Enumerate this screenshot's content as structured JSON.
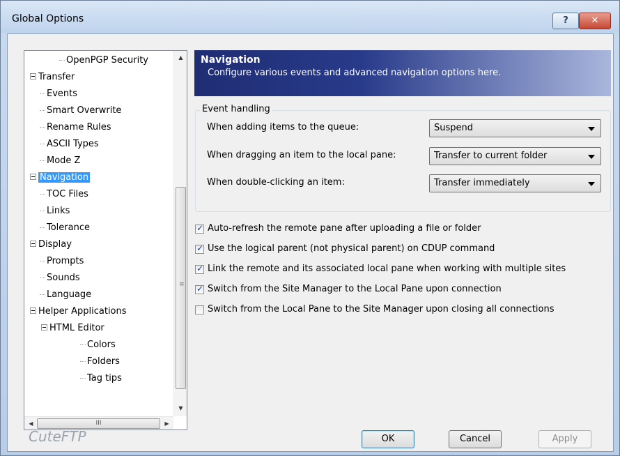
{
  "window": {
    "title": "Global Options",
    "help_label": "?",
    "close_label": "✕"
  },
  "tree": {
    "items": [
      {
        "label": "OpenPGP Security",
        "level": 2,
        "expander": false,
        "selected": false
      },
      {
        "label": "Transfer",
        "level": 0,
        "expander": true,
        "selected": false
      },
      {
        "label": "Events",
        "level": 1,
        "expander": false,
        "selected": false
      },
      {
        "label": "Smart Overwrite",
        "level": 1,
        "expander": false,
        "selected": false
      },
      {
        "label": "Rename Rules",
        "level": 1,
        "expander": false,
        "selected": false
      },
      {
        "label": "ASCII Types",
        "level": 1,
        "expander": false,
        "selected": false
      },
      {
        "label": "Mode Z",
        "level": 1,
        "expander": false,
        "selected": false
      },
      {
        "label": "Navigation",
        "level": 0,
        "expander": true,
        "selected": true
      },
      {
        "label": "TOC Files",
        "level": 1,
        "expander": false,
        "selected": false
      },
      {
        "label": "Links",
        "level": 1,
        "expander": false,
        "selected": false
      },
      {
        "label": "Tolerance",
        "level": 1,
        "expander": false,
        "selected": false
      },
      {
        "label": "Display",
        "level": 0,
        "expander": true,
        "selected": false
      },
      {
        "label": "Prompts",
        "level": 1,
        "expander": false,
        "selected": false
      },
      {
        "label": "Sounds",
        "level": 1,
        "expander": false,
        "selected": false
      },
      {
        "label": "Language",
        "level": 1,
        "expander": false,
        "selected": false
      },
      {
        "label": "Helper Applications",
        "level": 0,
        "expander": true,
        "selected": false
      },
      {
        "label": "HTML Editor",
        "level": 1,
        "expander": true,
        "selected": false
      },
      {
        "label": "Colors",
        "level": 2,
        "expander": false,
        "selected": false
      },
      {
        "label": "Folders",
        "level": 2,
        "expander": false,
        "selected": false
      },
      {
        "label": "Tag tips",
        "level": 2,
        "expander": false,
        "selected": false
      }
    ],
    "hscroll_thumb_label": "III"
  },
  "header": {
    "title": "Navigation",
    "description": "Configure various events and advanced navigation options here."
  },
  "event_handling": {
    "legend": "Event handling",
    "rows": [
      {
        "label": "When adding items to the queue:",
        "value": "Suspend"
      },
      {
        "label": "When dragging an item to the local pane:",
        "value": "Transfer to current folder"
      },
      {
        "label": "When double-clicking an item:",
        "value": "Transfer immediately"
      }
    ]
  },
  "options": [
    {
      "label": "Auto-refresh the remote pane after uploading a file or folder",
      "checked": true
    },
    {
      "label": "Use the logical parent (not physical parent) on CDUP command",
      "checked": true
    },
    {
      "label": "Link the remote and its associated local pane when working with multiple sites",
      "checked": true
    },
    {
      "label": "Switch from the Site Manager to the Local Pane upon connection",
      "checked": true
    },
    {
      "label": "Switch from the Local Pane to the Site Manager upon closing all connections",
      "checked": false
    }
  ],
  "brand": "CuteFTP",
  "buttons": {
    "ok": "OK",
    "cancel": "Cancel",
    "apply": "Apply"
  }
}
